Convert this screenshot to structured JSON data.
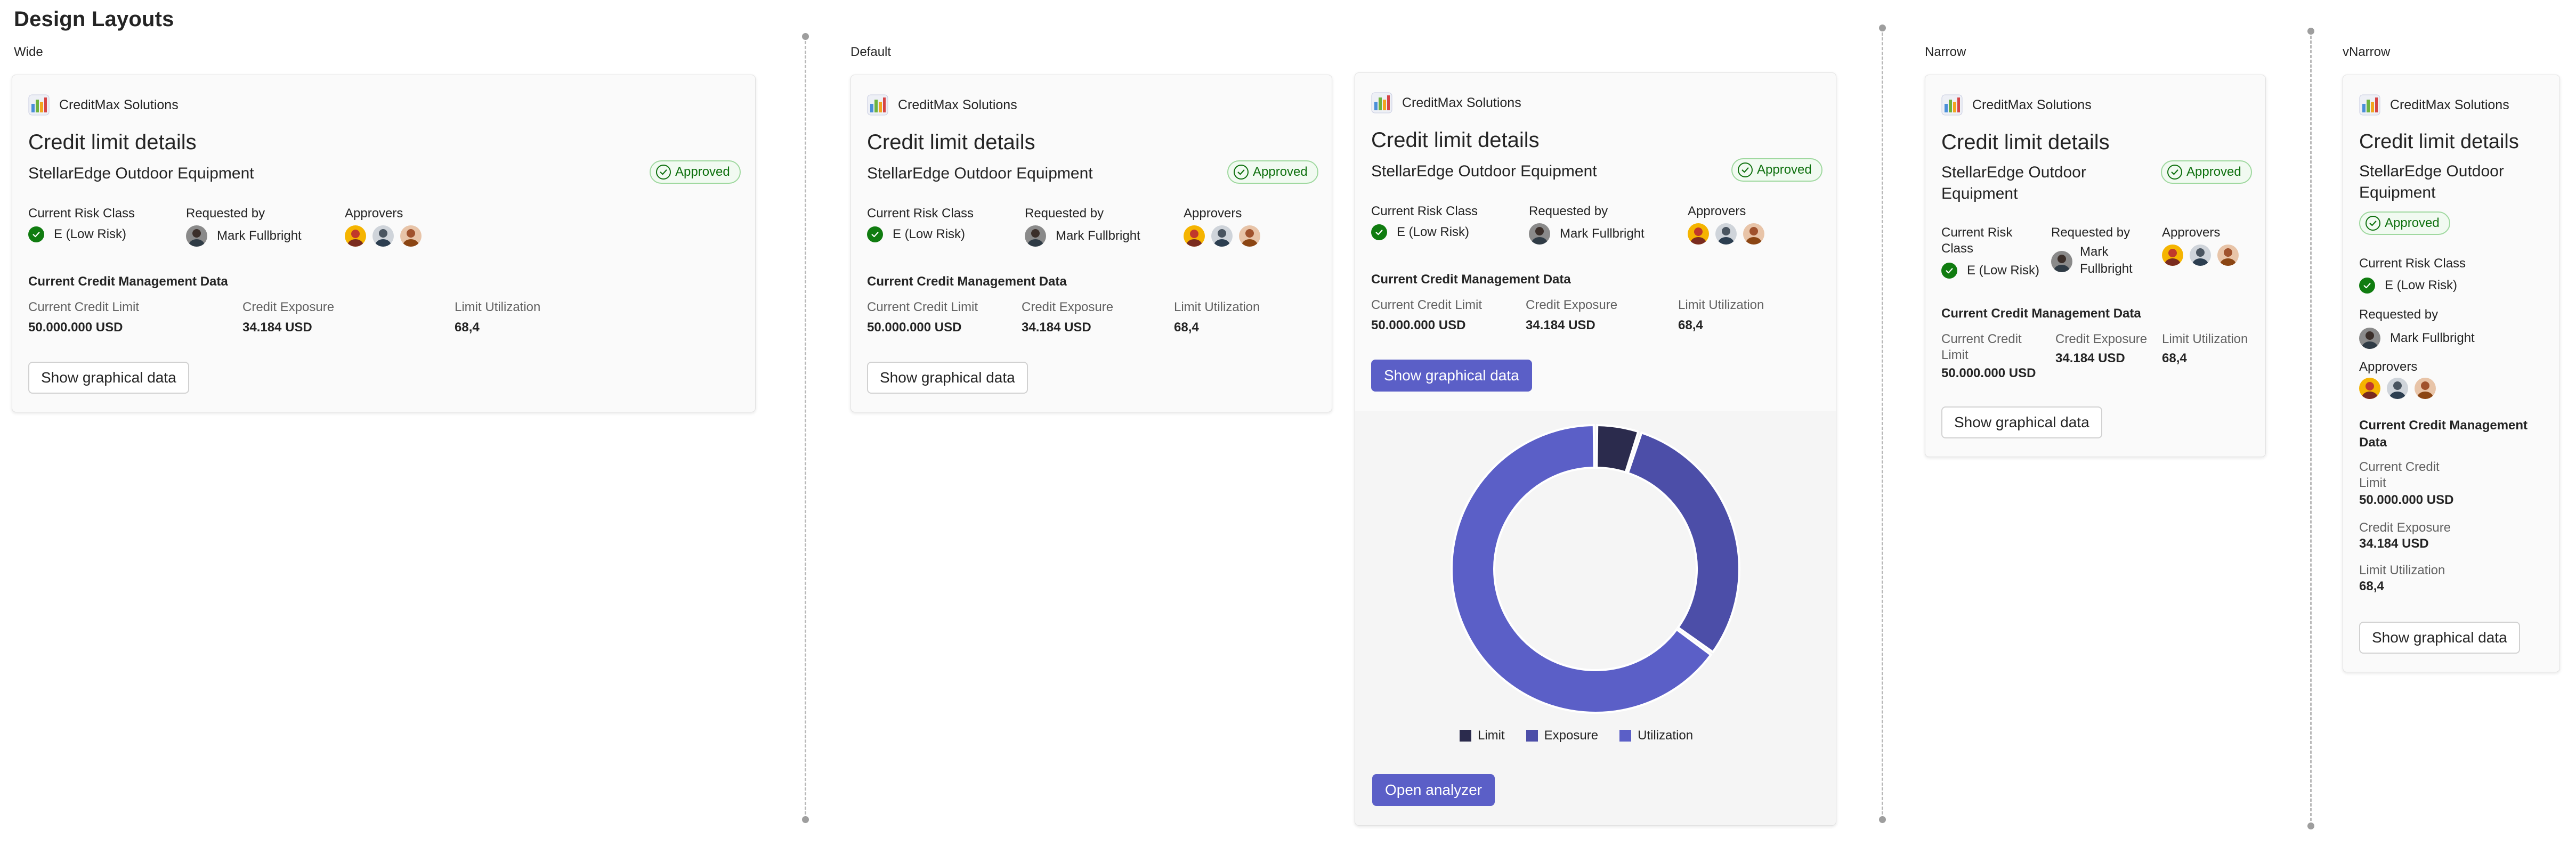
{
  "page": {
    "title": "Design Layouts"
  },
  "sections": {
    "wide": "Wide",
    "default": "Default",
    "narrow": "Narrow",
    "vnarrow": "vNarrow"
  },
  "card": {
    "app_name": "CreditMax Solutions",
    "heading": "Credit limit details",
    "company": "StellarEdge Outdoor Equipment",
    "status": "Approved",
    "risk_label": "Current Risk Class",
    "risk_value": "E (Low Risk)",
    "requested_label": "Requested by",
    "requested_value": "Mark Fullbright",
    "approvers_label": "Approvers",
    "mgmt_title": "Current Credit Management Data",
    "limit_label": "Current Credit Limit",
    "limit_value": "50.000.000 USD",
    "exposure_label": "Credit Exposure",
    "exposure_value": "34.184 USD",
    "util_label": "Limit Utilization",
    "util_value": "68,4",
    "show_button": "Show graphical data",
    "open_button": "Open analyzer"
  },
  "narrow_text": {
    "company_l1": "StellarEdge Outdoor",
    "company_l2": "Equipment",
    "risk_l1": "Current Risk",
    "risk_l2": "Class",
    "mark_l1": "Mark",
    "mark_l2": "Fullbright",
    "limit_l1": "Current Credit",
    "limit_l2": "Limit",
    "mgmt_l1": "Current Credit Management",
    "mgmt_l2": "Data"
  },
  "colors": {
    "accent": "#5b5fc7",
    "approved": "#0e700e",
    "risk_green": "#107c10"
  },
  "chart_data": {
    "type": "pie",
    "donut": true,
    "categories": [
      "Limit",
      "Exposure",
      "Utilization"
    ],
    "values": [
      5,
      30,
      65
    ],
    "colors": [
      "#2b2b4d",
      "#4c4ea8",
      "#5b5fc7"
    ],
    "legend": "bottom"
  }
}
